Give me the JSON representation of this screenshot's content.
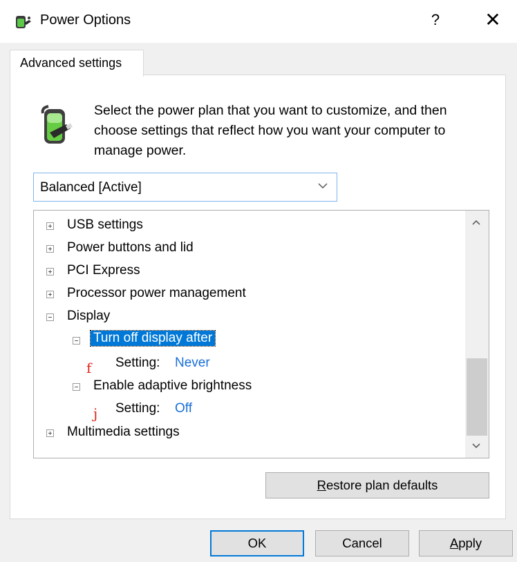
{
  "window": {
    "title": "Power Options",
    "help": "?",
    "close": "✕"
  },
  "tab": {
    "label": "Advanced settings"
  },
  "description": "Select the power plan that you want to customize, and then choose settings that reflect how you want your computer to manage power.",
  "plan_select": {
    "value": "Balanced [Active]"
  },
  "tree": {
    "items": [
      {
        "label": "USB settings",
        "state": "collapsed"
      },
      {
        "label": "Power buttons and lid",
        "state": "collapsed"
      },
      {
        "label": "PCI Express",
        "state": "collapsed"
      },
      {
        "label": "Processor power management",
        "state": "collapsed"
      },
      {
        "label": "Display",
        "state": "expanded"
      },
      {
        "label": "Turn off display after",
        "state": "expanded",
        "selected": true
      },
      {
        "marker": "f",
        "setting_label": "Setting:",
        "setting_value": "Never"
      },
      {
        "label": "Enable adaptive brightness",
        "state": "expanded"
      },
      {
        "marker": "j",
        "setting_label": "Setting:",
        "setting_value": "Off"
      },
      {
        "label": "Multimedia settings",
        "state": "collapsed"
      }
    ]
  },
  "buttons": {
    "restore_prefix": "R",
    "restore_rest": "estore plan defaults",
    "ok": "OK",
    "cancel": "Cancel",
    "apply_prefix": "A",
    "apply_rest": "pply"
  },
  "colors": {
    "accent": "#0078d7",
    "setting_value": "#1a6ed8",
    "marker": "#e0241a"
  }
}
